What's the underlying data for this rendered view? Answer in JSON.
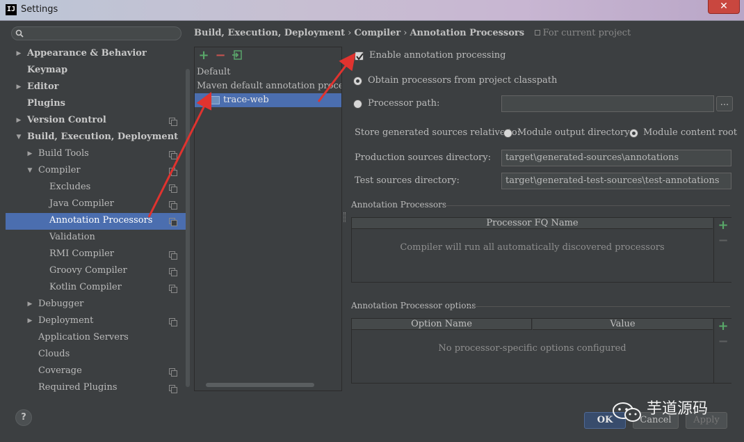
{
  "window": {
    "title": "Settings",
    "app_icon": "IJ",
    "close_label": "✕"
  },
  "sidebar": {
    "search_placeholder": "",
    "items": [
      {
        "label": "Appearance & Behavior",
        "arrow": "▶",
        "bold": true
      },
      {
        "label": "Keymap",
        "arrow": "",
        "bold": true
      },
      {
        "label": "Editor",
        "arrow": "▶",
        "bold": true
      },
      {
        "label": "Plugins",
        "arrow": "",
        "bold": true
      },
      {
        "label": "Version Control",
        "arrow": "▶",
        "bold": true
      },
      {
        "label": "Build, Execution, Deployment",
        "arrow": "▼",
        "bold": true
      },
      {
        "label": "Build Tools",
        "arrow": "▶"
      },
      {
        "label": "Compiler",
        "arrow": "▼"
      },
      {
        "label": "Excludes",
        "arrow": ""
      },
      {
        "label": "Java Compiler",
        "arrow": ""
      },
      {
        "label": "Annotation Processors",
        "arrow": "",
        "selected": true
      },
      {
        "label": "Validation",
        "arrow": ""
      },
      {
        "label": "RMI Compiler",
        "arrow": ""
      },
      {
        "label": "Groovy Compiler",
        "arrow": ""
      },
      {
        "label": "Kotlin Compiler",
        "arrow": ""
      },
      {
        "label": "Debugger",
        "arrow": "▶"
      },
      {
        "label": "Deployment",
        "arrow": "▶"
      },
      {
        "label": "Application Servers",
        "arrow": ""
      },
      {
        "label": "Clouds",
        "arrow": ""
      },
      {
        "label": "Coverage",
        "arrow": ""
      },
      {
        "label": "Required Plugins",
        "arrow": ""
      }
    ]
  },
  "breadcrumb": {
    "part1": "Build, Execution, Deployment",
    "part2": "Compiler",
    "part3": "Annotation Processors",
    "separator": "›",
    "scope": "For current project"
  },
  "profiles": {
    "add": "+",
    "remove": "−",
    "items": [
      {
        "label": "Default"
      },
      {
        "label": "Maven default annotation processors"
      },
      {
        "label": "trace-web",
        "selected": true
      }
    ]
  },
  "settings": {
    "enable_label": "Enable annotation processing",
    "enable_checked": true,
    "obtain_label": "Obtain processors from project classpath",
    "processor_path_label": "Processor path:",
    "processor_path_value": "",
    "browse_label": "...",
    "store_label": "Store generated sources relative to:",
    "module_output_label": "Module output directory",
    "module_content_label": "Module content root",
    "production_label": "Production sources directory:",
    "production_value": "target\\generated-sources\\annotations",
    "test_label": "Test sources directory:",
    "test_value": "target\\generated-test-sources\\test-annotations"
  },
  "annotation_processors": {
    "title": "Annotation Processors",
    "column": "Processor FQ Name",
    "empty": "Compiler will run all automatically discovered processors"
  },
  "processor_options": {
    "title": "Annotation Processor options",
    "col_name": "Option Name",
    "col_value": "Value",
    "empty": "No processor-specific options configured"
  },
  "buttons": {
    "help": "?",
    "ok": "OK",
    "cancel": "Cancel",
    "apply": "Apply"
  },
  "watermark": {
    "text": "芋道源码",
    "logo": "wechat-logo"
  },
  "colors": {
    "selection": "#0d293e",
    "list_selection": "#4b6eaf",
    "accent_red": "#e0332f",
    "plus_green": "#59a869"
  }
}
